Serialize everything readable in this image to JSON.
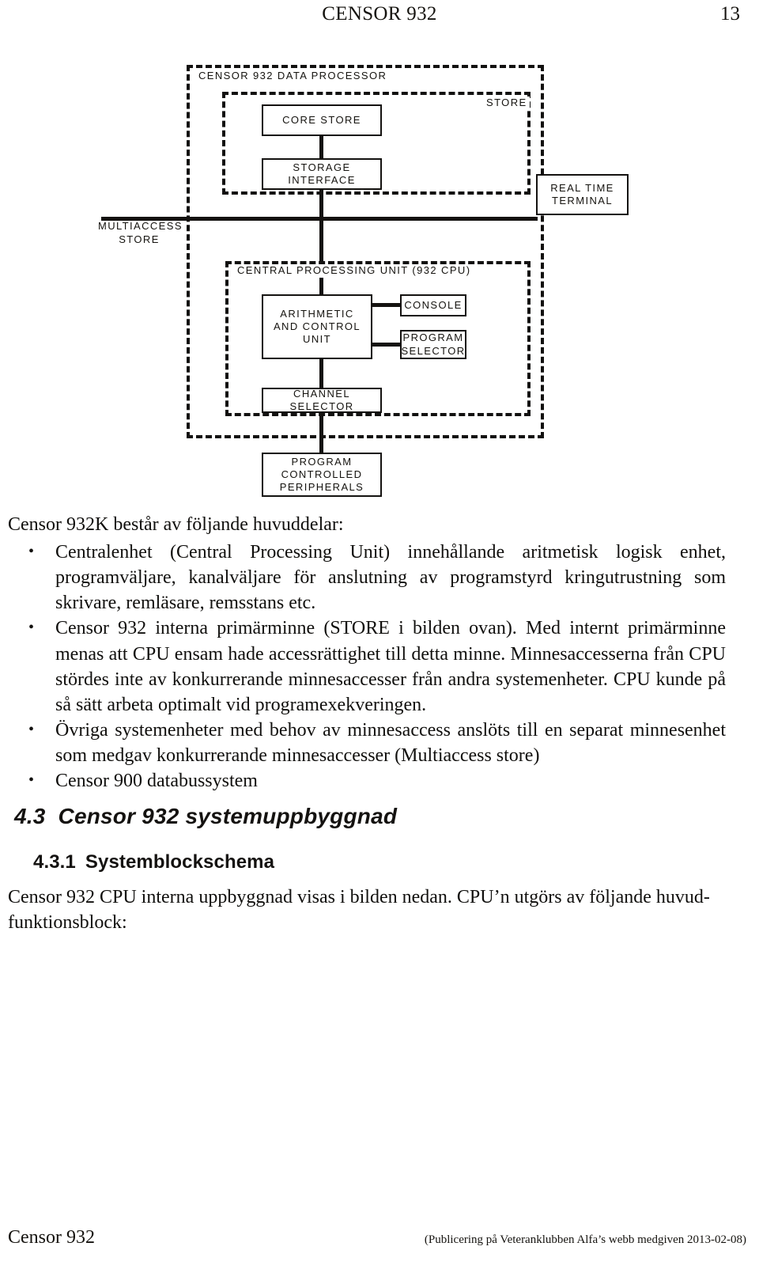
{
  "header": {
    "title": "CENSOR 932",
    "page_number": "13"
  },
  "figure": {
    "enclosures": {
      "data_processor": "CENSOR 932 DATA PROCESSOR",
      "store": "STORE",
      "cpu_line1": "CENTRAL",
      "cpu_line2": "PROCESSING",
      "cpu_line3": "UNIT (932 CPU)"
    },
    "external_labels": {
      "multiaccess_line1": "MULTIACCESS",
      "multiaccess_line2": "STORE"
    },
    "blocks": {
      "core_store": "CORE STORE",
      "storage_interface_line1": "STORAGE",
      "storage_interface_line2": "INTERFACE",
      "arithmetic_line1": "ARITHMETIC",
      "arithmetic_line2": "AND CONTROL",
      "arithmetic_line3": "UNIT",
      "console": "CONSOLE",
      "program_selector_line1": "PROGRAM",
      "program_selector_line2": "SELECTOR",
      "channel_selector": "CHANNEL SELECTOR",
      "real_time_terminal_line1": "REAL TIME",
      "real_time_terminal_line2": "TERMINAL",
      "peripherals_line1": "PROGRAM",
      "peripherals_line2": "CONTROLLED",
      "peripherals_line3": "PERIPHERALS"
    }
  },
  "body": {
    "lead": "Censor 932K består av följande huvuddelar:",
    "bullets": [
      "Centralenhet (Central Processing Unit) innehållande aritmetisk logisk enhet, programväljare, kanalväljare för anslutning av programstyrd kringutrustning som skrivare, remläsare, remsstans etc.",
      "Censor 932 interna primärminne (STORE i bilden ovan). Med internt primärminne menas att CPU ensam hade accessrättighet till detta minne. Minnesaccesserna från CPU stördes inte av konkurrerande minnesaccesser från andra systemenheter. CPU kunde på så sätt arbeta optimalt vid programexekveringen.",
      "Övriga systemenheter med behov av minnesaccess anslöts till en separat minnesenhet som medgav konkurrerande minnesaccesser (Multiaccess store)",
      "Censor 900 databussystem"
    ]
  },
  "headings": {
    "section_number": "4.3",
    "section_title": "Censor 932 systemuppbyggnad",
    "subsection_number": "4.3.1",
    "subsection_title": "Systemblockschema"
  },
  "tail_paragraph": "Censor 932 CPU interna uppbyggnad visas i bilden nedan. CPU’n utgörs av följande huvud-",
  "tail_paragraph_last_line": "funktionsblock:",
  "footer": {
    "left": "Censor 932",
    "right": "(Publicering på Veteranklubben Alfa’s webb medgiven 2013-02-08)"
  }
}
